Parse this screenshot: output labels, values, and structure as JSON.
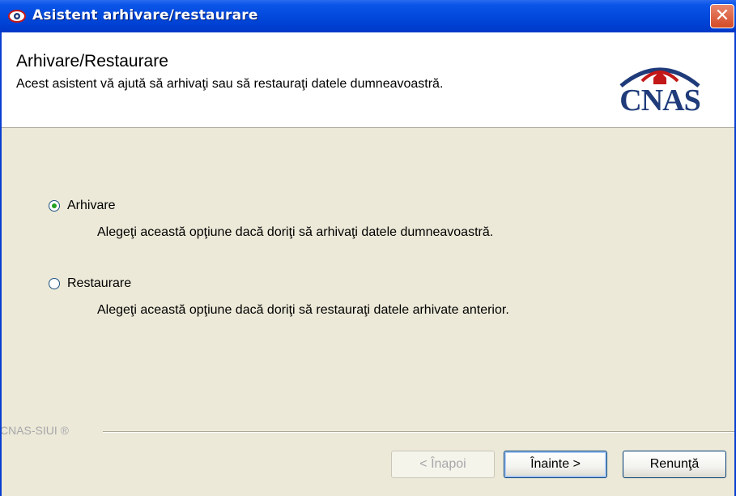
{
  "window": {
    "title": "Asistent arhivare/restaurare",
    "close_label": "✕"
  },
  "header": {
    "title": "Arhivare/Restaurare",
    "description": "Acest asistent vă ajută să arhivaţi sau să restauraţi datele dumneavoastră.",
    "logo_text": "CNAS"
  },
  "options": [
    {
      "label": "Arhivare",
      "description": "Alegeţi această opţiune dacă doriţi să arhivaţi datele dumneavoastră.",
      "selected": true
    },
    {
      "label": "Restaurare",
      "description": "Alegeţi această opţiune dacă doriţi să restauraţi datele arhivate anterior.",
      "selected": false
    }
  ],
  "footer": {
    "brand": "CNAS-SIUI ®"
  },
  "buttons": {
    "back": "< Înapoi",
    "next": "Înainte >",
    "cancel": "Renunţă"
  },
  "colors": {
    "titlebar": "#0046d9",
    "dialog_bg": "#ece9d8",
    "radio_dot": "#21a121",
    "logo": "#1f3b7a"
  }
}
